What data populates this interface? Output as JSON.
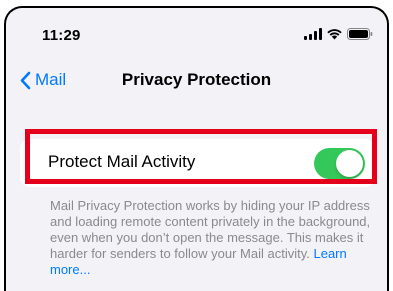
{
  "status_bar": {
    "time": "11:29",
    "icons": [
      "cellular-signal-icon",
      "wifi-icon",
      "battery-icon"
    ]
  },
  "nav": {
    "back_label": "Mail",
    "title": "Privacy Protection"
  },
  "setting": {
    "label": "Protect Mail Activity",
    "toggle_on": true
  },
  "footer": {
    "text": "Mail Privacy Protection works by hiding your IP address and loading remote content privately in the background, even when you don’t open the message. This makes it harder for senders to follow your Mail activity. ",
    "link_label": "Learn more..."
  },
  "colors": {
    "accent": "#007aff",
    "toggle_on": "#34c759",
    "highlight": "#e4001b",
    "background": "#f2f2f7",
    "footer_text": "#8a8a8e"
  }
}
